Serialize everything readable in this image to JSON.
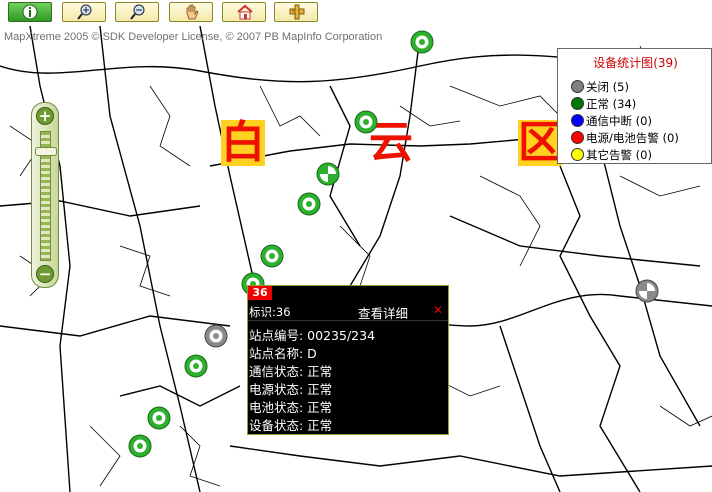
{
  "toolbar": {
    "buttons": [
      {
        "name": "info-icon"
      },
      {
        "name": "zoom-in-icon"
      },
      {
        "name": "zoom-out-icon"
      },
      {
        "name": "pan-hand-icon"
      },
      {
        "name": "home-icon"
      },
      {
        "name": "measure-icon"
      }
    ]
  },
  "map": {
    "copyright": "MapXtreme 2005 © SDK Developer License, © 2007 PB MapInfo Corporation",
    "region_chars": [
      "白",
      "云",
      "区"
    ],
    "zoom": {
      "plus": "+",
      "minus": "−"
    }
  },
  "legend": {
    "title": "设备统计图",
    "total": "(39)",
    "items": [
      {
        "label": "关闭",
        "count": "(5)",
        "color": "#808080"
      },
      {
        "label": "正常",
        "count": "(34)",
        "color": "#007700"
      },
      {
        "label": "通信中断",
        "count": "(0)",
        "color": "#0000ff"
      },
      {
        "label": "电源/电池告警",
        "count": "(0)",
        "color": "#ff0000"
      },
      {
        "label": "其它告警",
        "count": "(0)",
        "color": "#ffff00"
      }
    ]
  },
  "popup": {
    "badge": "36",
    "id_label": "标识:",
    "id_value": "36",
    "detail_link": "查看详细",
    "close": "✕",
    "rows": [
      "站点编号: 00235/234",
      "站点名称: D",
      "通信状态: 正常",
      "电源状态: 正常",
      "电池状态: 正常",
      "设备状态: 正常"
    ]
  },
  "colors": {
    "station_normal": "#22aa22",
    "station_closed": "#808080",
    "region_text": "#ee1100",
    "region_bg": "#ffd21f",
    "toolbar_bg": "#f3e9a8"
  }
}
